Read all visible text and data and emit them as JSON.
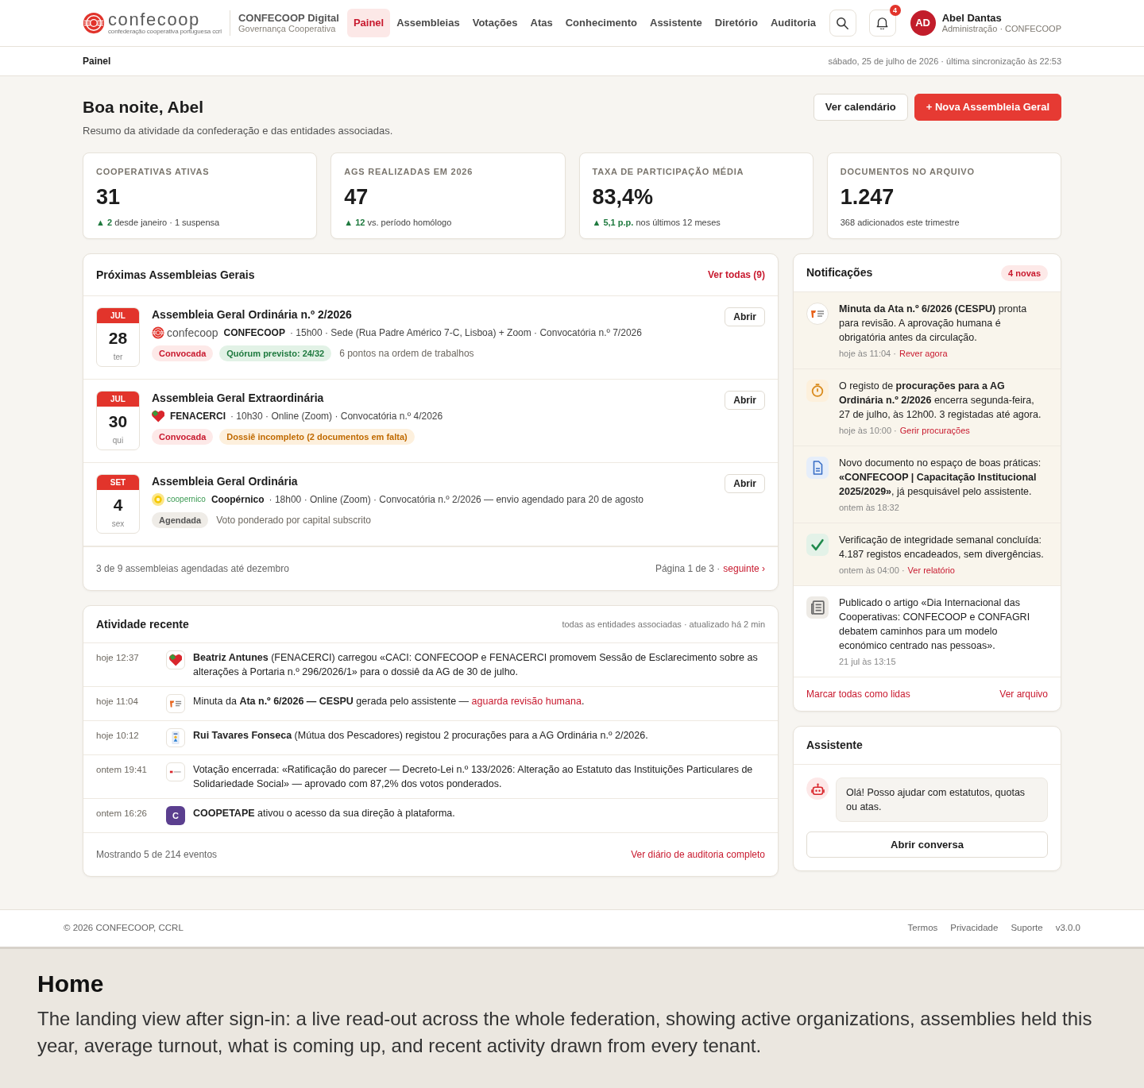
{
  "header": {
    "logo": {
      "wordmark": "confecoop",
      "tagline": "confederação cooperativa portuguesa ccrl"
    },
    "brand": {
      "title": "CONFECOOP Digital",
      "subtitle": "Governança Cooperativa"
    },
    "nav": [
      {
        "label": "Painel",
        "selected": true
      },
      {
        "label": "Assembleias",
        "selected": false
      },
      {
        "label": "Votações",
        "selected": false
      },
      {
        "label": "Atas",
        "selected": false
      },
      {
        "label": "Conhecimento",
        "selected": false
      },
      {
        "label": "Assistente",
        "selected": false
      },
      {
        "label": "Diretório",
        "selected": false
      },
      {
        "label": "Auditoria",
        "selected": false
      }
    ],
    "notifications_count": "4",
    "user": {
      "initials": "AD",
      "name": "Abel Dantas",
      "role": "Administração · CONFECOOP"
    }
  },
  "breadcrumb": {
    "current": "Painel",
    "status": "sábado, 25 de julho de 2026 · última sincronização às 22:53"
  },
  "page_header": {
    "title": "Boa noite, Abel",
    "subtitle": "Resumo da atividade da confederação e das entidades associadas.",
    "buttons": [
      {
        "label": "Ver calendário",
        "kind": "secondary"
      },
      {
        "label": "+ Nova Assembleia Geral",
        "kind": "primary"
      }
    ]
  },
  "stats": [
    {
      "label": "COOPERATIVAS ATIVAS",
      "value": "31",
      "delta": "▲ 2",
      "note": "desde janeiro · 1 suspensa"
    },
    {
      "label": "AGS REALIZADAS EM 2026",
      "value": "47",
      "delta": "▲ 12",
      "note": "vs. período homólogo"
    },
    {
      "label": "TAXA DE PARTICIPAÇÃO MÉDIA",
      "value": "83,4%",
      "delta": "▲ 5,1 p.p.",
      "note": "nos últimos 12 meses"
    },
    {
      "label": "DOCUMENTOS NO ARQUIVO",
      "value": "1.247",
      "note": "368 adicionados este trimestre"
    }
  ],
  "assemblies": {
    "title": "Próximas Assembleias Gerais",
    "view_all": "Ver todas (9)",
    "items": [
      {
        "month": "JUL",
        "day": "28",
        "weekday": "ter",
        "title": "Assembleia Geral Ordinária n.º 2/2026",
        "org": {
          "kind": "ring",
          "wordmark": "confecoop",
          "name": "CONFECOOP"
        },
        "details": "· 15h00 · Sede (Rua Padre Américo 7-C, Lisboa) + Zoom · Convocatória n.º 7/2026",
        "tags": [
          {
            "label": "Convocada",
            "kind": "danger"
          },
          {
            "label": "Quórum previsto: 24/32",
            "kind": "success"
          }
        ],
        "note": "6 pontos na ordem de trabalhos",
        "action": "Abrir"
      },
      {
        "month": "JUL",
        "day": "30",
        "weekday": "qui",
        "title": "Assembleia Geral Extraordinária",
        "org": {
          "kind": "heart",
          "name": "FENACERCI"
        },
        "details": "· 10h30 · Online (Zoom) · Convocatória n.º 4/2026",
        "tags": [
          {
            "label": "Convocada",
            "kind": "danger"
          },
          {
            "label": "Dossiê incompleto (2 documentos em falta)",
            "kind": "warning"
          }
        ],
        "action": "Abrir"
      },
      {
        "month": "SET",
        "day": "4",
        "weekday": "sex",
        "title": "Assembleia Geral Ordinária",
        "org": {
          "kind": "sun",
          "wordmark": "coopernico",
          "name": "Coopérnico"
        },
        "details": "· 18h00 · Online (Zoom) · Convocatória n.º 2/2026 — envio agendado para 20 de agosto",
        "tags": [
          {
            "label": "Agendada",
            "kind": "neutral"
          }
        ],
        "note": "Voto ponderado por capital subscrito",
        "action": "Abrir"
      }
    ],
    "summary": "3 de 9 assembleias agendadas até dezembro",
    "page": "Página 1 de 3 ·",
    "next": "seguinte ›"
  },
  "activity": {
    "title": "Atividade recente",
    "scope": "todas as entidades associadas · atualizado há 2 min",
    "items": [
      {
        "time": "hoje 12:37",
        "kind": "heart",
        "text": "**Beatriz Antunes** (FENACERCI) carregou «CACI: CONFECOOP e FENACERCI promovem Sessão de Esclarecimento sobre as alterações à Portaria n.º 296/2026/1» para o dossiê da AG de 30 de julho."
      },
      {
        "time": "hoje 11:04",
        "kind": "logo",
        "text": "Minuta da **Ata n.º 6/2026 — CESPU** gerada pelo assistente — ",
        "link": "aguarda revisão humana",
        "after": "."
      },
      {
        "time": "hoje 10:12",
        "kind": "flag",
        "text": "**Rui Tavares Fonseca** (Mútua dos Pescadores) registou 2 procurações para a AG Ordinária n.º 2/2026."
      },
      {
        "time": "ontem 19:41",
        "kind": "strip",
        "text": "Votação encerrada: «Ratificação do parecer — Decreto-Lei n.º 133/2026: Alteração ao Estatuto das Instituições Particulares de Solidariedade Social» — aprovado com 87,2% dos votos ponderados."
      },
      {
        "time": "ontem 16:26",
        "kind": "letter",
        "letter": "C",
        "text": "**COOPETAPE** ativou o acesso da sua direção à plataforma."
      }
    ],
    "summary": "Mostrando 5 de 214 eventos",
    "link": "Ver diário de auditoria completo"
  },
  "notifications": {
    "title": "Notificações",
    "badge": "4 novas",
    "items": [
      {
        "kind": "logo",
        "unread": true,
        "text": "**Minuta da Ata n.º 6/2026 (CESPU)** pronta para revisão. A aprovação humana é obrigatória antes da circulação.",
        "time": "hoje às 11:04 ·",
        "link": "Rever agora"
      },
      {
        "kind": "clock",
        "unread": true,
        "text": "O registo de **procurações para a AG Ordinária n.º 2/2026** encerra segunda-feira, 27 de julho, às 12h00. 3 registadas até agora.",
        "time": "hoje às 10:00 ·",
        "link": "Gerir procurações"
      },
      {
        "kind": "document",
        "unread": true,
        "text": "Novo documento no espaço de boas práticas: **«CONFECOOP | Capacitação Institucional 2025/2029»**, já pesquisável pelo assistente.",
        "time": "ontem às 18:32"
      },
      {
        "kind": "check",
        "unread": true,
        "text": "Verificação de integridade semanal concluída: 4.187 registos encadeados, sem divergências.",
        "time": "ontem às 04:00 ·",
        "link": "Ver relatório"
      },
      {
        "kind": "news",
        "unread": false,
        "text": "Publicado o artigo «Dia Internacional das Cooperativas: CONFECOOP e CONFAGRI debatem caminhos para um modelo económico centrado nas pessoas».",
        "time": "21 jul às 13:15"
      }
    ],
    "mark_all": "Marcar todas como lidas",
    "archive": "Ver arquivo"
  },
  "assistant": {
    "title": "Assistente",
    "message": "Olá! Posso ajudar com estatutos, quotas ou atas.",
    "button": "Abrir conversa"
  },
  "footer": {
    "copyright": "© 2026 CONFECOOP, CCRL",
    "links": [
      "Termos",
      "Privacidade",
      "Suporte"
    ],
    "version": "v3.0.0"
  },
  "caption": {
    "title": "Home",
    "description": "The landing view after sign-in: a live read-out across the whole federation, showing active organizations, assemblies held this year, average turnout, what is coming up, and recent activity drawn from every tenant."
  }
}
